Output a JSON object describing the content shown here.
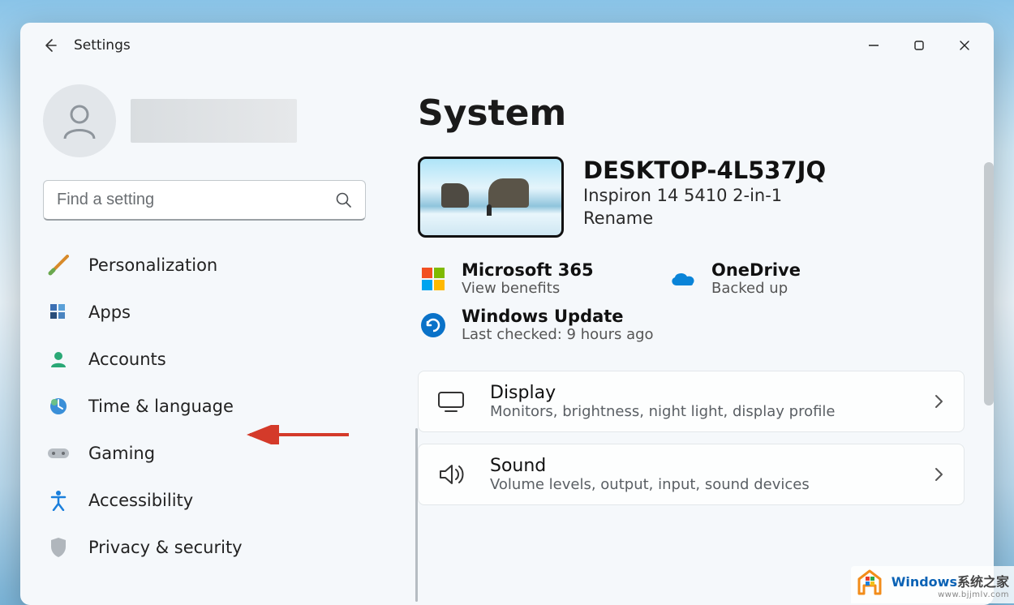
{
  "window": {
    "title": "Settings"
  },
  "search": {
    "placeholder": "Find a setting"
  },
  "sidebar": {
    "items": [
      {
        "label": "Personalization"
      },
      {
        "label": "Apps"
      },
      {
        "label": "Accounts"
      },
      {
        "label": "Time & language"
      },
      {
        "label": "Gaming"
      },
      {
        "label": "Accessibility"
      },
      {
        "label": "Privacy & security"
      }
    ]
  },
  "page": {
    "heading": "System",
    "device": {
      "name": "DESKTOP-4L537JQ",
      "model": "Inspiron 14 5410 2-in-1",
      "rename": "Rename"
    },
    "tiles": {
      "ms365": {
        "title": "Microsoft 365",
        "sub": "View benefits"
      },
      "onedrive": {
        "title": "OneDrive",
        "sub": "Backed up"
      },
      "update": {
        "title": "Windows Update",
        "sub": "Last checked: 9 hours ago"
      }
    },
    "cards": {
      "display": {
        "title": "Display",
        "sub": "Monitors, brightness, night light, display profile"
      },
      "sound": {
        "title": "Sound",
        "sub": "Volume levels, output, input, sound devices"
      }
    }
  },
  "watermark": {
    "brand1": "Windows",
    "brand2": "系统之家",
    "url": "www.bjjmlv.com"
  }
}
